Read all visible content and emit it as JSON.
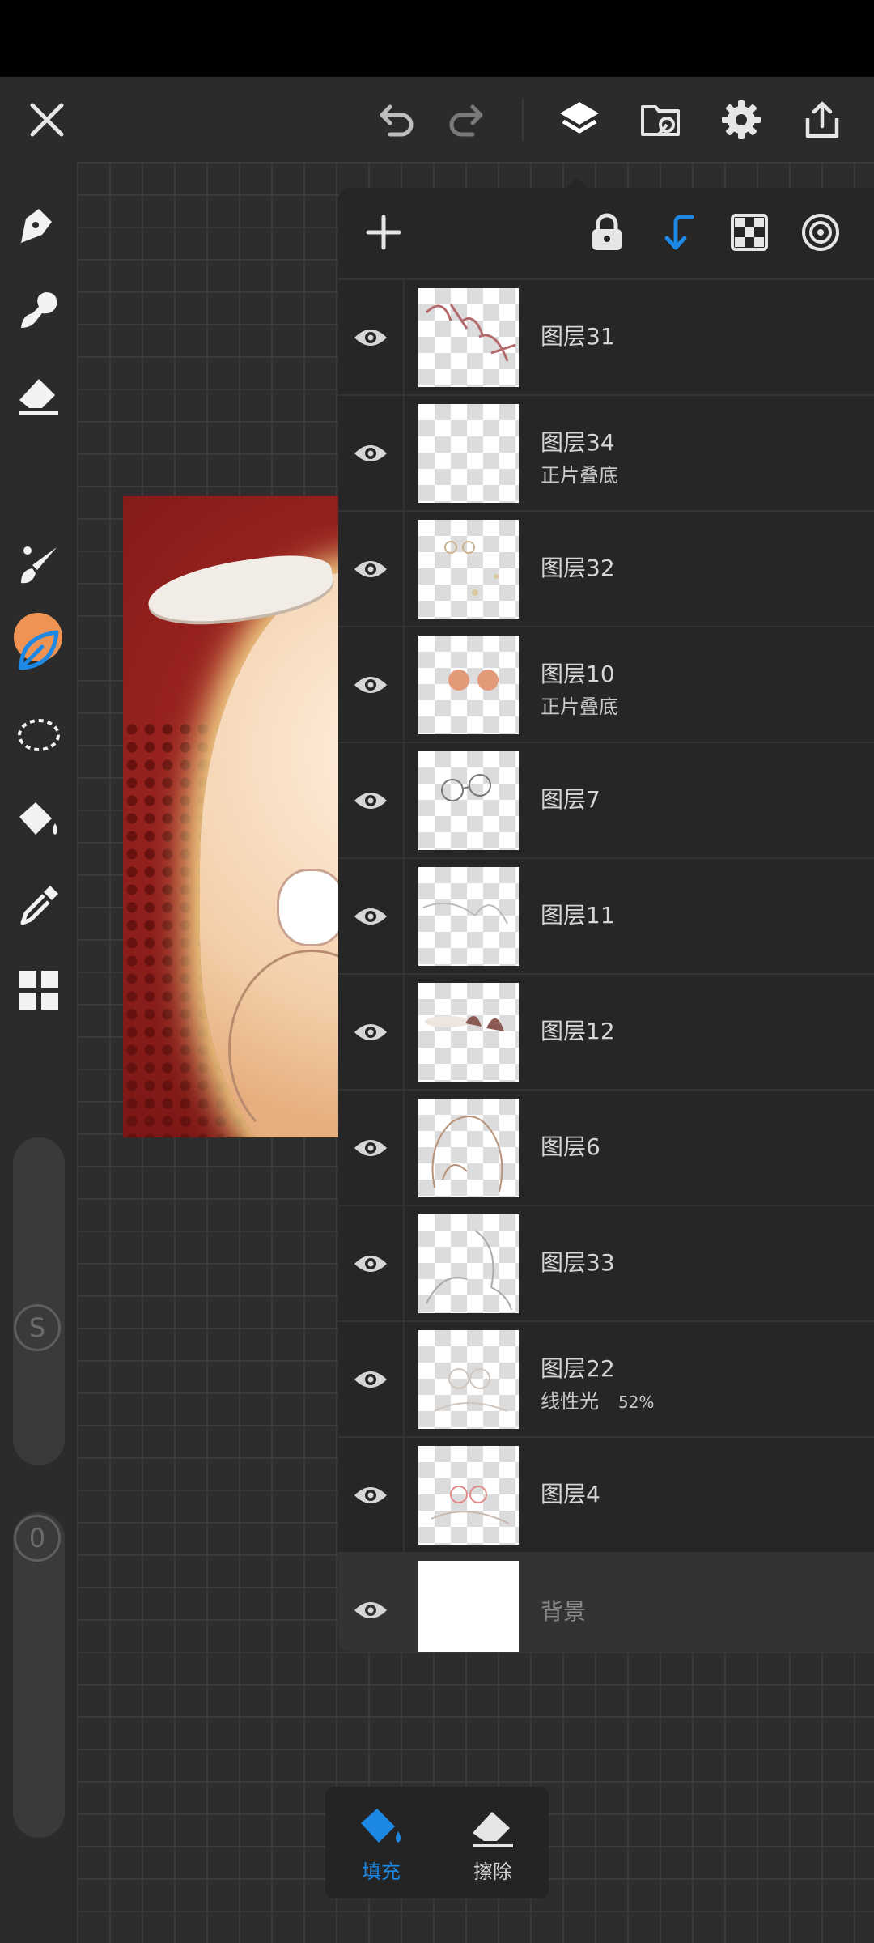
{
  "colors": {
    "accent": "#1e88e5",
    "current_brush_color": "#ef9354",
    "panel_bg": "#262626",
    "toolbar_bg": "#2b2b2b"
  },
  "toolbar": {
    "icons": [
      "close-icon",
      "undo-icon",
      "redo-icon",
      "layers-icon",
      "open-file-icon",
      "settings-icon",
      "share-icon"
    ]
  },
  "tools": [
    "pen-icon",
    "smudge-icon",
    "eraser-icon",
    "color-swatch",
    "brush-icon",
    "leaf-brush-icon",
    "lasso-icon",
    "fill-bucket-icon",
    "eyedropper-icon",
    "grid-icon"
  ],
  "sliders": {
    "size_label": "S",
    "opacity_label": "0"
  },
  "layer_panel": {
    "header_icons": [
      "add-layer-icon",
      "lock-icon",
      "clip-icon",
      "alpha-lock-icon",
      "reference-icon"
    ],
    "layers": [
      {
        "name": "图层31",
        "blend": "",
        "opacity": ""
      },
      {
        "name": "图层34",
        "blend": "正片叠底",
        "opacity": ""
      },
      {
        "name": "图层32",
        "blend": "",
        "opacity": ""
      },
      {
        "name": "图层10",
        "blend": "正片叠底",
        "opacity": ""
      },
      {
        "name": "图层7",
        "blend": "",
        "opacity": ""
      },
      {
        "name": "图层11",
        "blend": "",
        "opacity": ""
      },
      {
        "name": "图层12",
        "blend": "",
        "opacity": ""
      },
      {
        "name": "图层6",
        "blend": "",
        "opacity": ""
      },
      {
        "name": "图层33",
        "blend": "",
        "opacity": ""
      },
      {
        "name": "图层22",
        "blend": "线性光",
        "opacity": "52%"
      },
      {
        "name": "图层4",
        "blend": "",
        "opacity": ""
      },
      {
        "name": "背景",
        "blend": "",
        "opacity": ""
      }
    ]
  },
  "bottom_actions": {
    "fill_label": "填充",
    "erase_label": "擦除"
  }
}
